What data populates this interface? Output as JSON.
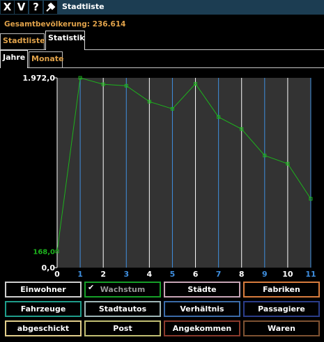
{
  "window": {
    "close_label": "X",
    "copy_label": "V",
    "help_label": "?",
    "title": "Stadtliste"
  },
  "population_text": "Gesamtbevölkerung: 236.614",
  "tabs": [
    {
      "label": "Stadtliste",
      "active": false
    },
    {
      "label": "Statistik",
      "active": true
    }
  ],
  "subtabs": [
    {
      "label": "Jahre",
      "active": true
    },
    {
      "label": "Monate",
      "active": false
    }
  ],
  "chart_data": {
    "type": "line",
    "x": [
      0,
      1,
      2,
      3,
      4,
      5,
      6,
      7,
      8,
      9,
      10,
      11
    ],
    "y": [
      168.0,
      1972.0,
      1905.0,
      1890.0,
      1725.0,
      1650.0,
      1910.0,
      1565.0,
      1440.0,
      1165.0,
      1080.0,
      715.0
    ],
    "y_max_label": "1.972,0",
    "y_min_label": "0,0",
    "first_value_label": "168,0",
    "ylim": [
      0,
      1972.0
    ],
    "x_ticks": [
      "0",
      "1",
      "2",
      "3",
      "4",
      "5",
      "6",
      "7",
      "8",
      "9",
      "10",
      "11"
    ],
    "line_color": "#1db31d",
    "background": "#333333",
    "colors": {
      "tick_white": "#ffffff",
      "tick_blue": "#3f8fe0",
      "value_label": "#1db31d"
    }
  },
  "buttons": [
    {
      "label": "Einwohner",
      "color": "#cfcfcf",
      "checked": false,
      "dim": false
    },
    {
      "label": "Wachstum",
      "color": "#16a028",
      "checked": true,
      "dim": true
    },
    {
      "label": "Städte",
      "color": "#c7a5b6",
      "checked": false,
      "dim": false
    },
    {
      "label": "Fabriken",
      "color": "#d87c3e",
      "checked": false,
      "dim": false
    },
    {
      "label": "Fahrzeuge",
      "color": "#1f9e8b",
      "checked": false,
      "dim": false
    },
    {
      "label": "Stadtautos",
      "color": "#9fb7b8",
      "checked": false,
      "dim": false
    },
    {
      "label": "Verhältnis",
      "color": "#3b6ba8",
      "checked": false,
      "dim": false
    },
    {
      "label": "Passagiere",
      "color": "#2b3d8a",
      "checked": false,
      "dim": false
    },
    {
      "label": "abgeschickt",
      "color": "#e2cf8c",
      "checked": false,
      "dim": false
    },
    {
      "label": "Post",
      "color": "#c2bf74",
      "checked": false,
      "dim": false
    },
    {
      "label": "Angekommen",
      "color": "#8a3a2c",
      "checked": false,
      "dim": false
    },
    {
      "label": "Waren",
      "color": "#7e5232",
      "checked": false,
      "dim": false
    }
  ]
}
